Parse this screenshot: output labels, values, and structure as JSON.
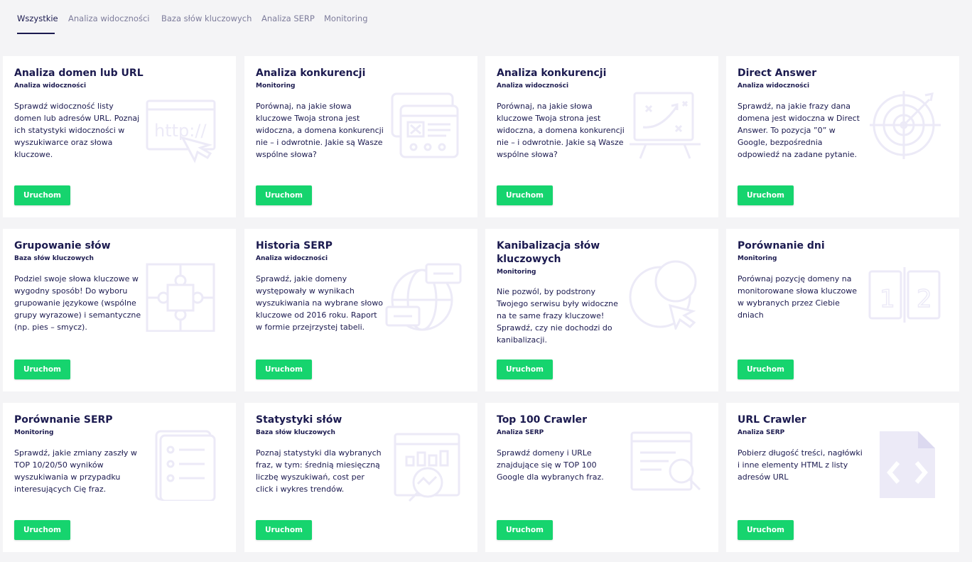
{
  "tabs": [
    {
      "label": "Wszystkie",
      "active": true
    },
    {
      "label": "Analiza widoczności"
    },
    {
      "label": "Baza słów kluczowych"
    },
    {
      "label": "Analiza SERP"
    },
    {
      "label": "Monitoring"
    }
  ],
  "button_label": "Uruchom",
  "colors": {
    "accent": "#16d46e",
    "text": "#1b1a4f",
    "illustration": "#eceaf7"
  },
  "cards": [
    {
      "title": "Analiza domen lub URL",
      "category": "Analiza widoczności",
      "description": "Sprawdź widoczność listy domen lub adresów URL. Poznaj ich statystyki widoczności w wyszukiwarce oraz słowa kluczowe.",
      "icon": "http-browser-icon"
    },
    {
      "title": "Analiza konkurencji",
      "category": "Monitoring",
      "description": "Porównaj, na jakie słowa kluczowe Twoja strona jest widoczna, a domena konkurencji nie – i odwrotnie. Jakie są Wasze wspólne słowa?",
      "icon": "browser-windows-icon"
    },
    {
      "title": "Analiza konkurencji",
      "category": "Analiza widoczności",
      "description": "Porównaj, na jakie słowa kluczowe Twoja strona jest widoczna, a domena konkurencji nie – i odwrotnie. Jakie są Wasze wspólne słowa?",
      "icon": "strategy-board-icon"
    },
    {
      "title": "Direct Answer",
      "category": "Analiza widoczności",
      "description": "Sprawdź, na jakie frazy dana domena jest widoczna w Direct Answer. To pozycja ”0” w Google, bezpośrednia odpowiedź na zadane pytanie.",
      "icon": "target-icon"
    },
    {
      "title": "Grupowanie słów",
      "category": "Baza słów kluczowych",
      "description": "Podziel swoje słowa kluczowe w wygodny sposób! Do wyboru grupowanie językowe (wspólne grupy wyrazowe) i semantyczne (np. pies – smycz).",
      "icon": "puzzle-icon"
    },
    {
      "title": "Historia SERP",
      "category": "Analiza widoczności",
      "description": "Sprawdź, jakie domeny występowały w wynikach wyszukiwania na wybrane słowo kluczowe od 2016 roku. Raport w formie przejrzystej tabeli.",
      "icon": "globe-chat-icon"
    },
    {
      "title": "Kanibalizacja słów kluczowych",
      "category": "Monitoring",
      "description": "Nie pozwól, by podstrony Twojego serwisu były widoczne na te same frazy kluczowe! Sprawdź, czy nie dochodzi do kanibalizacji.",
      "icon": "circle-cursor-icon"
    },
    {
      "title": "Porównanie dni",
      "category": "Monitoring",
      "description": "Porównaj pozycję domeny na monitorowane słowa kluczowe w wybranych przez Ciebie dniach",
      "icon": "compare-days-icon"
    },
    {
      "title": "Porównanie SERP",
      "category": "Monitoring",
      "description": "Sprawdź, jakie zmiany zaszły w TOP 10/20/50 wyników wyszukiwania w przypadku interesujących Cię fraz.",
      "icon": "checklist-icon"
    },
    {
      "title": "Statystyki słów",
      "category": "Baza słów kluczowych",
      "description": "Poznaj statystyki dla wybranych fraz, w tym: średnią miesięczną liczbę wyszukiwań, cost per click i wykres trendów.",
      "icon": "stats-magnifier-icon"
    },
    {
      "title": "Top 100 Crawler",
      "category": "Analiza SERP",
      "description": "Sprawdź domeny i URLe znajdujące się w TOP 100 Google dla wybranych fraz.",
      "icon": "crawler-search-icon"
    },
    {
      "title": "URL Crawler",
      "category": "Analiza SERP",
      "description": "Pobierz długość treści, nagłówki i inne elementy HTML z listy adresów URL",
      "icon": "code-file-icon"
    }
  ]
}
